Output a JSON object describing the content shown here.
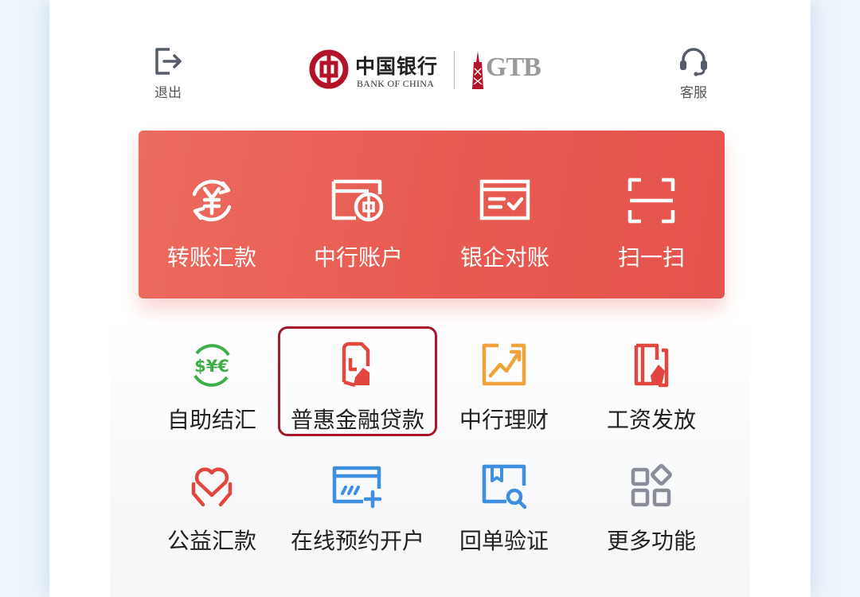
{
  "header": {
    "exit_label": "退出",
    "service_label": "客服",
    "logo": {
      "name_cn": "中国银行",
      "name_en": "BANK OF CHINA",
      "product": "GTB"
    }
  },
  "quick_actions": [
    {
      "label": "转账汇款",
      "icon": "yuan-transfer-icon"
    },
    {
      "label": "中行账户",
      "icon": "bank-card-icon"
    },
    {
      "label": "银企对账",
      "icon": "reconciliation-icon"
    },
    {
      "label": "扫一扫",
      "icon": "scan-icon"
    }
  ],
  "services": [
    {
      "label": "自助结汇",
      "icon": "currency-exchange-icon"
    },
    {
      "label": "普惠金融贷款",
      "icon": "loan-document-icon"
    },
    {
      "label": "中行理财",
      "icon": "trend-chart-icon"
    },
    {
      "label": "工资发放",
      "icon": "payroll-icon"
    },
    {
      "label": "公益汇款",
      "icon": "charity-heart-icon"
    },
    {
      "label": "在线预约开户",
      "icon": "card-add-icon"
    },
    {
      "label": "回单验证",
      "icon": "receipt-search-icon"
    },
    {
      "label": "更多功能",
      "icon": "more-grid-icon"
    }
  ],
  "colors": {
    "accent_red": "#e75a51",
    "highlight_border": "#a8182b",
    "green": "#3fae4a",
    "orange": "#f0a23a",
    "blue": "#3f8fe0",
    "gray_icon": "#8a8d99"
  }
}
